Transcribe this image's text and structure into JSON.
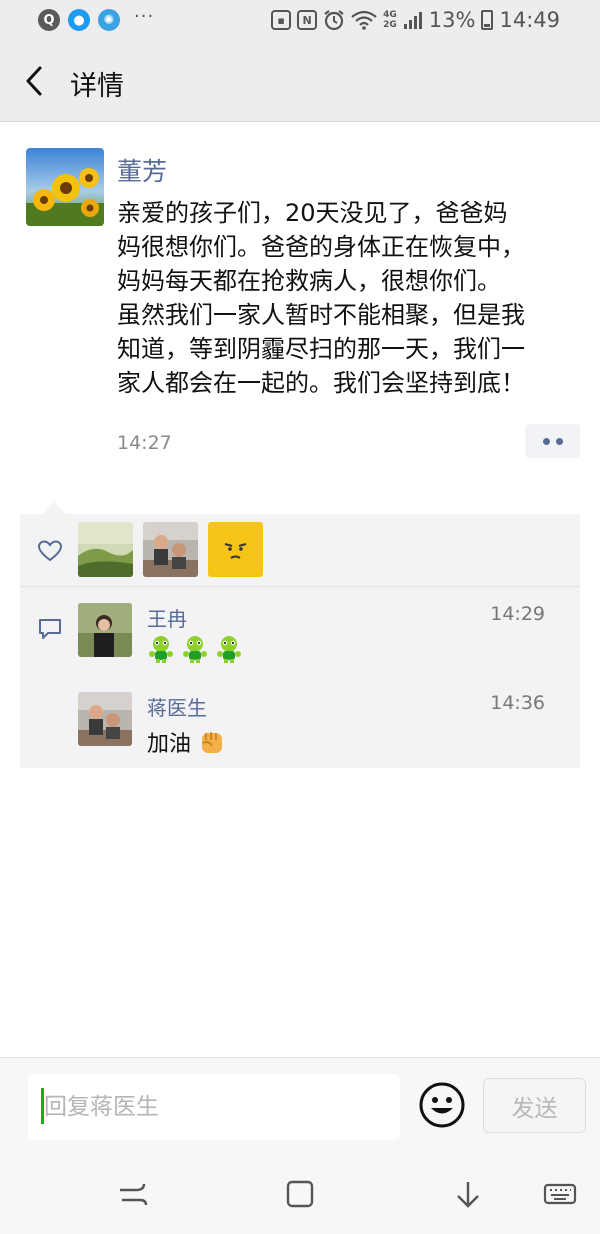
{
  "status_bar": {
    "battery_percent": "13%",
    "time": "14:49",
    "network_top": "4G",
    "network_bottom": "2G",
    "icons": [
      "qq-browser-icon",
      "qq-icon",
      "wechat-moments-icon",
      "more-dots-icon",
      "sim-icon",
      "nfc-icon",
      "alarm-icon",
      "wifi-icon",
      "signal-icon",
      "battery-icon"
    ]
  },
  "nav": {
    "title": "详情"
  },
  "post": {
    "author": "董芳",
    "lines": [
      "亲爱的孩子们，20天没见了，爸爸妈",
      "妈很想你们。爸爸的身体正在恢复中，",
      "妈妈每天都在抢救病人，很想你们。",
      "虽然我们一家人暂时不能相聚，但是我",
      "知道，等到阴霾尽扫的那一天，我们一",
      "家人都会在一起的。我们会坚持到底！"
    ],
    "time": "14:27"
  },
  "likes": {
    "count": 3
  },
  "comments": [
    {
      "name": "王冉",
      "time": "14:29",
      "text": "",
      "emoji": "frog-emoji ×3"
    },
    {
      "name": "蒋医生",
      "time": "14:36",
      "text": "加油",
      "emoji": "fist-emoji"
    }
  ],
  "reply": {
    "placeholder": "回复蒋医生",
    "send_label": "发送"
  },
  "colors": {
    "link": "#576b95",
    "header_bg": "#ededed",
    "panel_bg": "#f3f3f5",
    "caret": "#1aad19"
  }
}
